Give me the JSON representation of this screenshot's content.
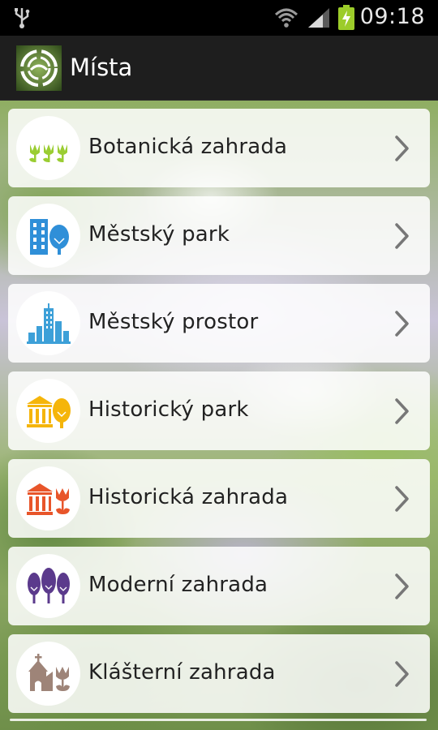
{
  "status_bar": {
    "time": "09:18",
    "icons": [
      "usb-icon",
      "wifi-icon",
      "signal-icon",
      "battery-charging-icon"
    ],
    "battery_color": "#9ccc2a"
  },
  "action_bar": {
    "title": "Místa",
    "logo": "app-logo-icon"
  },
  "places": [
    {
      "label": "Botanická zahrada",
      "icon": "tulips-icon",
      "color": "#9acd32"
    },
    {
      "label": "Městský park",
      "icon": "building-tree-icon",
      "color": "#2f8fd8"
    },
    {
      "label": "Městský prostor",
      "icon": "skyline-icon",
      "color": "#3da0d8"
    },
    {
      "label": "Historický park",
      "icon": "temple-tree-icon",
      "color": "#f5b50a"
    },
    {
      "label": "Historická zahrada",
      "icon": "temple-tulip-icon",
      "color": "#e8552a"
    },
    {
      "label": "Moderní zahrada",
      "icon": "three-trees-icon",
      "color": "#5b3a8c"
    },
    {
      "label": "Klášterní zahrada",
      "icon": "church-tulip-icon",
      "color": "#9e8478"
    }
  ]
}
